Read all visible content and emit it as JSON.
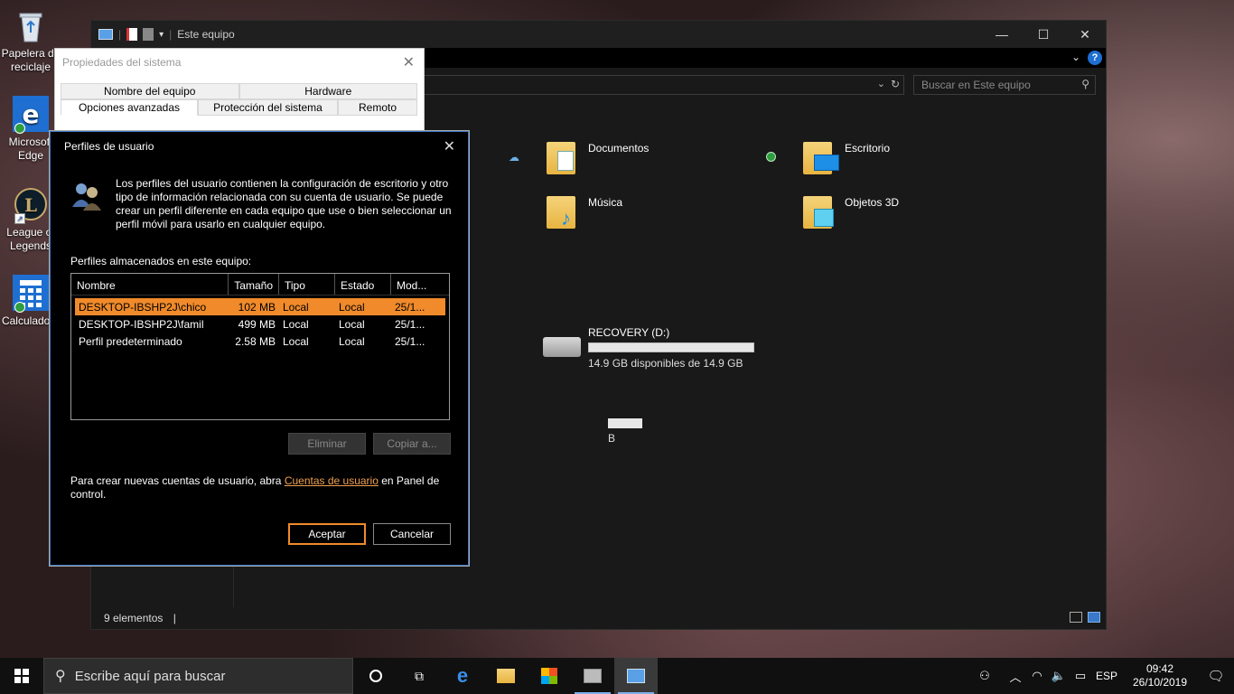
{
  "desktop": {
    "icons": [
      {
        "label": "Papelera de reciclaje"
      },
      {
        "label": "Microsoft Edge"
      },
      {
        "label": "League of Legends"
      },
      {
        "label": "Calculadora"
      }
    ]
  },
  "explorer": {
    "title": "Este equipo",
    "search_placeholder": "Buscar en Este equipo",
    "status": "9 elementos",
    "folders": [
      {
        "name": "Documentos"
      },
      {
        "name": "Escritorio"
      },
      {
        "name": "Música"
      },
      {
        "name": "Objetos 3D"
      }
    ],
    "drive": {
      "name": "RECOVERY (D:)",
      "free_text": "14.9 GB disponibles de 14.9 GB",
      "used_fraction": 0.0
    },
    "partial_letter": "B"
  },
  "sysprops": {
    "title": "Propiedades del sistema",
    "tabs_row1": [
      "Nombre del equipo",
      "Hardware"
    ],
    "tabs_row2": [
      "Opciones avanzadas",
      "Protección del sistema",
      "Remoto"
    ]
  },
  "profiles_dialog": {
    "title": "Perfiles de usuario",
    "description": "Los perfiles del usuario contienen la configuración de escritorio y otro tipo de información relacionada con su cuenta de usuario. Se puede crear un perfil diferente en cada equipo que use o bien seleccionar un perfil móvil para usarlo en cualquier equipo.",
    "list_label": "Perfiles almacenados en este equipo:",
    "columns": [
      "Nombre",
      "Tamaño",
      "Tipo",
      "Estado",
      "Mod..."
    ],
    "rows": [
      {
        "name": "DESKTOP-IBSHP2J\\chico",
        "size": "102 MB",
        "type": "Local",
        "state": "Local",
        "mod": "25/1..."
      },
      {
        "name": "DESKTOP-IBSHP2J\\famil",
        "size": "499 MB",
        "type": "Local",
        "state": "Local",
        "mod": "25/1..."
      },
      {
        "name": "Perfil predeterminado",
        "size": "2.58 MB",
        "type": "Local",
        "state": "Local",
        "mod": "25/1..."
      }
    ],
    "btn_delete": "Eliminar",
    "btn_copy": "Copiar a...",
    "footer_pre": "Para crear nuevas cuentas de usuario, abra ",
    "footer_link": "Cuentas de usuario",
    "footer_post": " en Panel de control.",
    "btn_ok": "Aceptar",
    "btn_cancel": "Cancelar"
  },
  "taskbar": {
    "search_placeholder": "Escribe aquí para buscar",
    "lang": "ESP",
    "time": "09:42",
    "date": "26/10/2019"
  },
  "colors": {
    "accent": "#f08a2a",
    "selection": "#f08a2a",
    "link": "#f0a050",
    "explorer_bg": "#191919"
  }
}
